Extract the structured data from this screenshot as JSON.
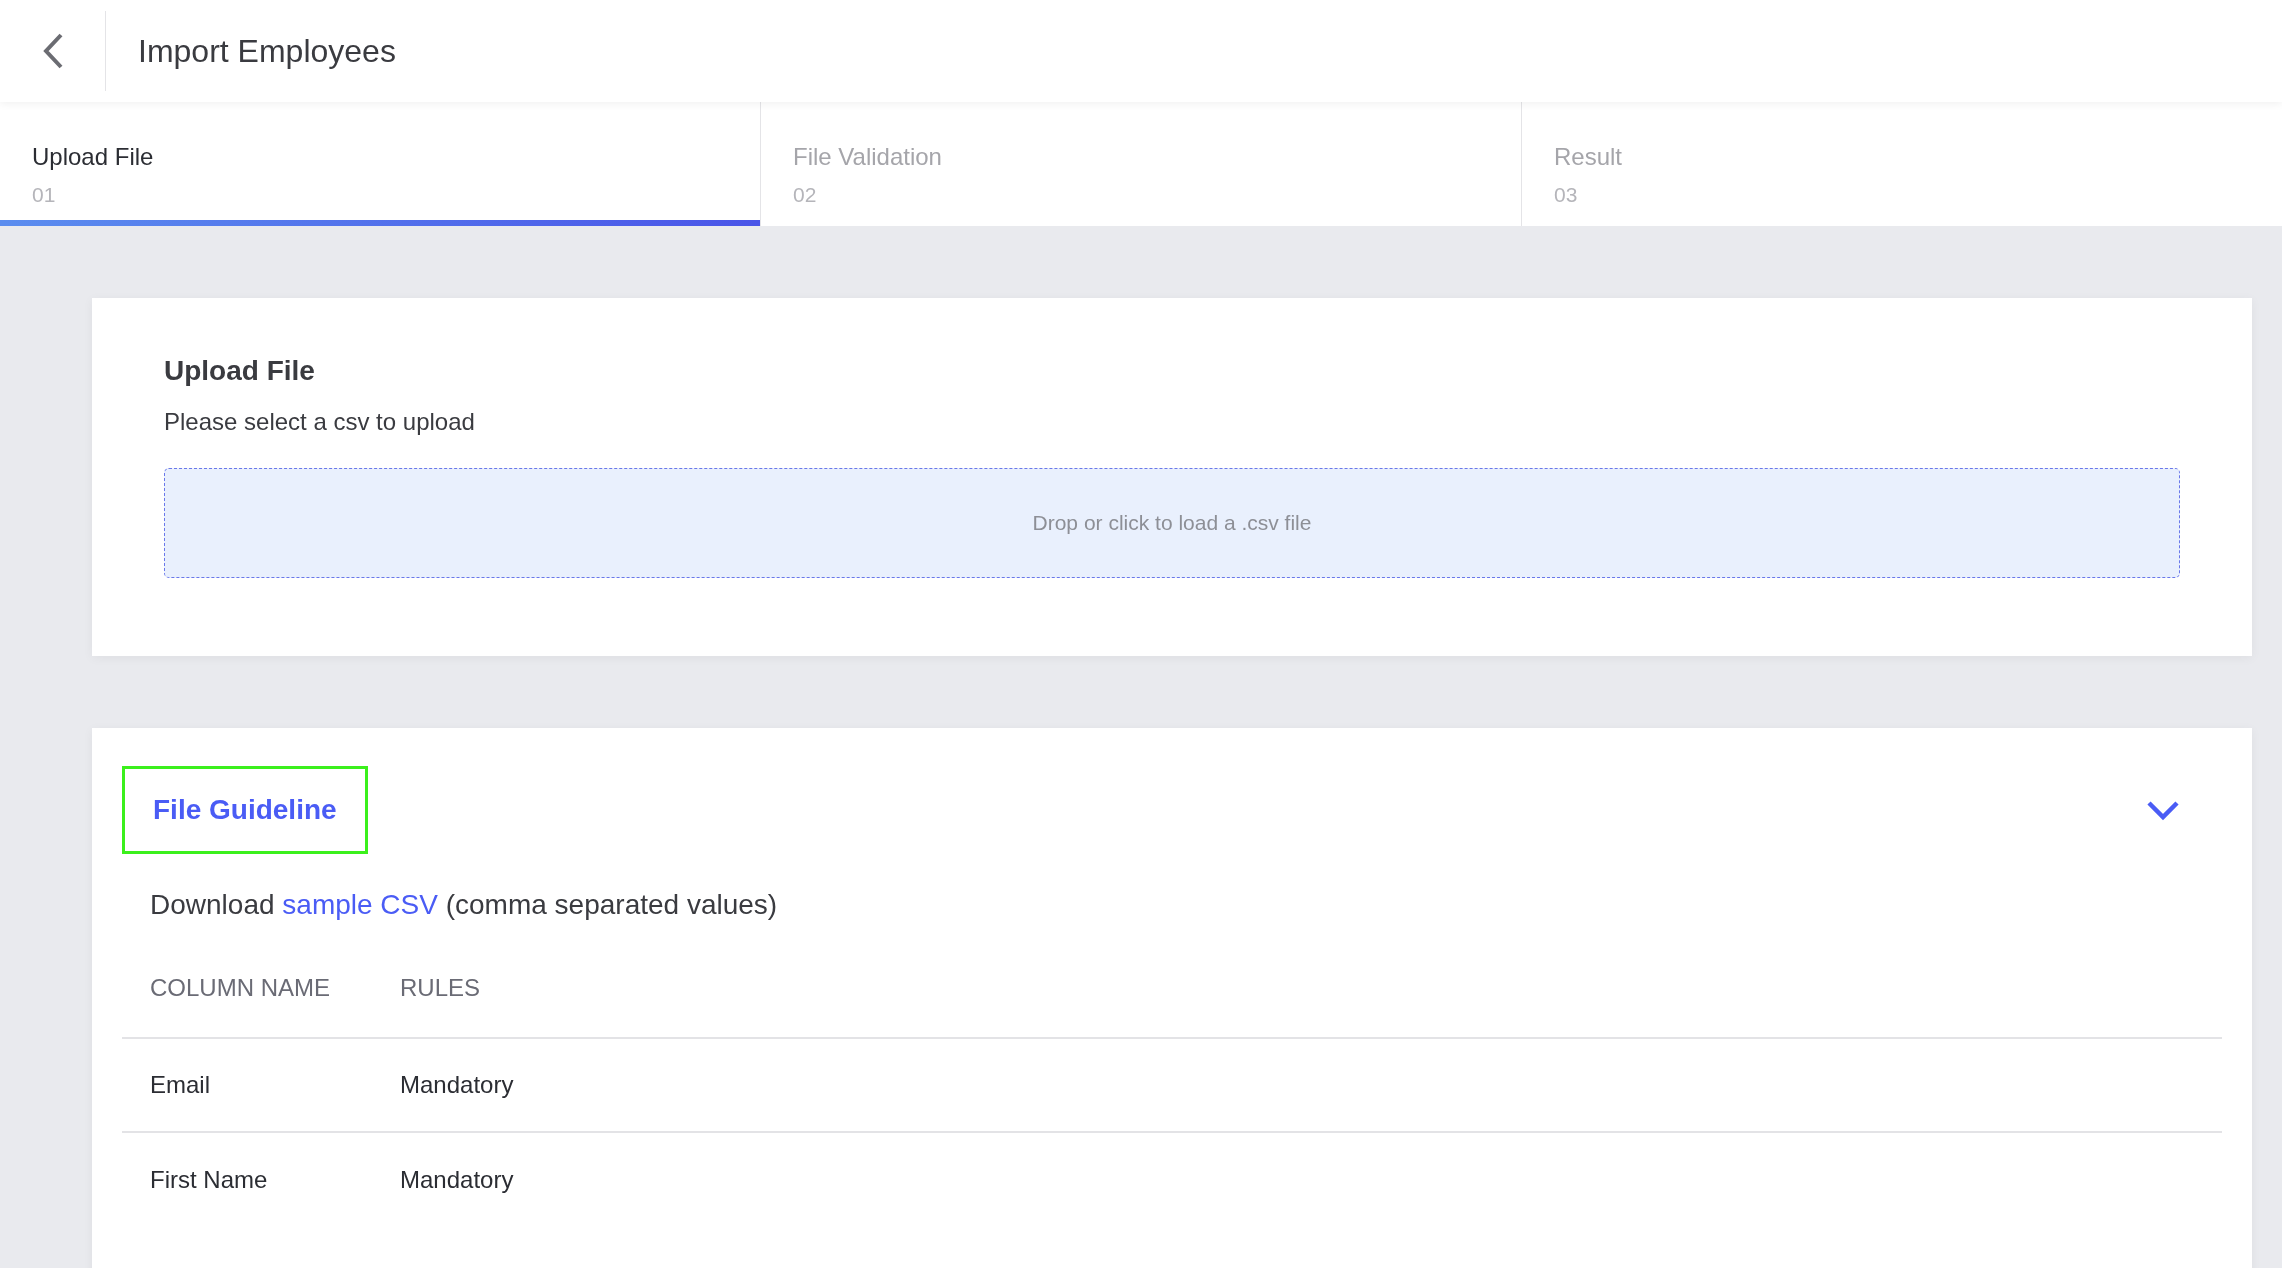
{
  "header": {
    "title": "Import Employees"
  },
  "steps": [
    {
      "label": "Upload File",
      "number": "01",
      "selected": true
    },
    {
      "label": "File Validation",
      "number": "02",
      "selected": false
    },
    {
      "label": "Result",
      "number": "03",
      "selected": false
    }
  ],
  "upload_card": {
    "title": "Upload File",
    "subtitle": "Please select a csv to upload",
    "dropzone_text": "Drop or click to load a .csv file"
  },
  "guideline": {
    "title": "File Guideline",
    "focused": true,
    "expanded": true,
    "download_text": [
      "Download ",
      "sample CSV",
      " (comma separated values)"
    ],
    "table": {
      "columns": [
        "COLUMN NAME",
        "RULES"
      ],
      "rows": [
        [
          "Email",
          "Mandatory"
        ],
        [
          "First Name",
          "Mandatory"
        ]
      ]
    }
  }
}
